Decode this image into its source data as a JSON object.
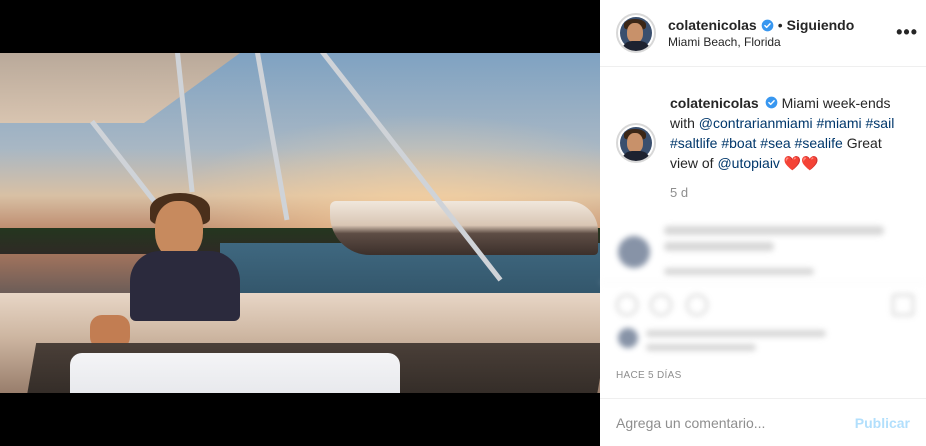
{
  "post": {
    "username": "colatenicolas",
    "verified": true,
    "following_label": "Siguiendo",
    "separator": "•",
    "location": "Miami Beach, Florida",
    "more_icon": "more-horizontal-icon",
    "more_label": "•••"
  },
  "caption": {
    "username": "colatenicolas",
    "text_start": "Miami week-ends with",
    "mentions_hashtags": [
      "@contrarianmiami",
      "#miami",
      "#sail",
      "#saltlife",
      "#boat",
      "#sea",
      "#sealife"
    ],
    "text_middle": "Great view of",
    "mention_end": "@utopiaiv",
    "emoji": "❤️❤️",
    "time_ago": "5 d"
  },
  "footer": {
    "date_label": "HACE 5 DÍAS",
    "comment_placeholder": "Agrega un comentario...",
    "publish_label": "Publicar"
  },
  "colors": {
    "link": "#00376b",
    "verified": "#3897f0",
    "publish_disabled": "#b2dffc",
    "muted": "#8e8e8e"
  }
}
